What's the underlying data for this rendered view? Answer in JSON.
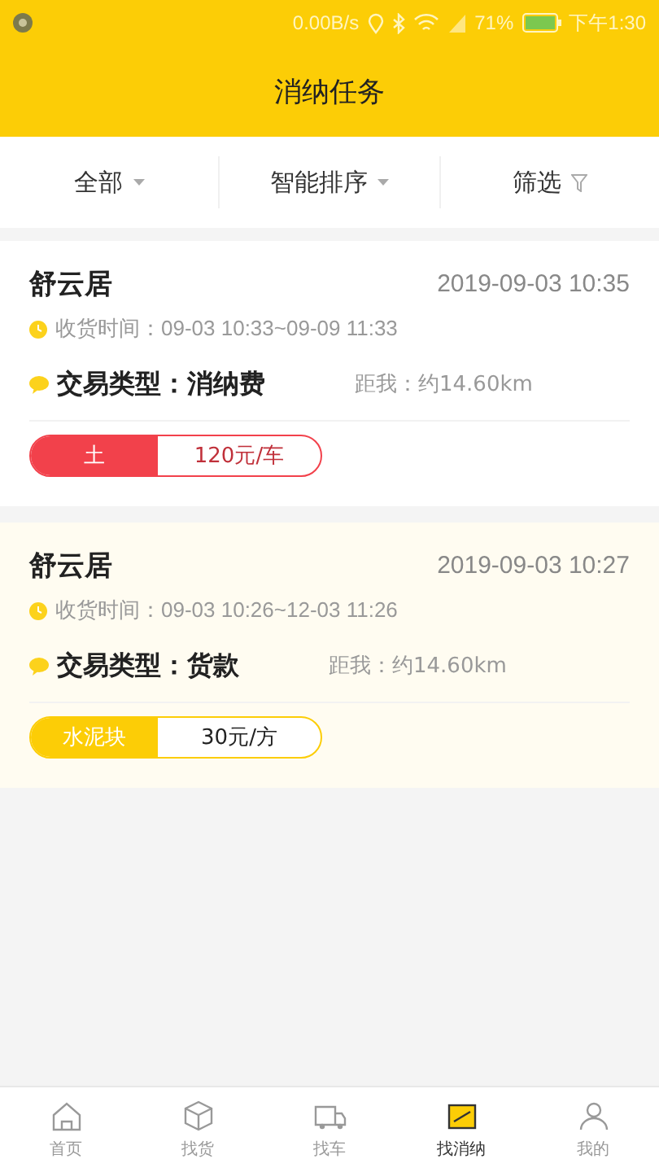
{
  "status_bar": {
    "speed": "0.00B/s",
    "battery": "71%",
    "time": "下午1:30"
  },
  "header": {
    "title": "消纳任务"
  },
  "filters": [
    {
      "label": "全部"
    },
    {
      "label": "智能排序"
    },
    {
      "label": "筛选"
    }
  ],
  "tasks": [
    {
      "name": "舒云居",
      "posted": "2019-09-03 10:35",
      "receive_time": "收货时间：09-03 10:33~09-09 11:33",
      "trade_type": "交易类型：消纳费",
      "distance": "距我：约14.60km",
      "material": "土",
      "price": "120元/车",
      "color": "#f2414b",
      "selected": false
    },
    {
      "name": "舒云居",
      "posted": "2019-09-03 10:27",
      "receive_time": "收货时间：09-03 10:26~12-03 11:26",
      "trade_type": "交易类型：货款",
      "distance": "距我：约14.60km",
      "material": "水泥块",
      "price": "30元/方",
      "color": "#fccd06",
      "selected": true
    }
  ],
  "nav": [
    {
      "label": "首页",
      "selected": false
    },
    {
      "label": "找货",
      "selected": false
    },
    {
      "label": "找车",
      "selected": false
    },
    {
      "label": "找消纳",
      "selected": true
    },
    {
      "label": "我的",
      "selected": false
    }
  ]
}
